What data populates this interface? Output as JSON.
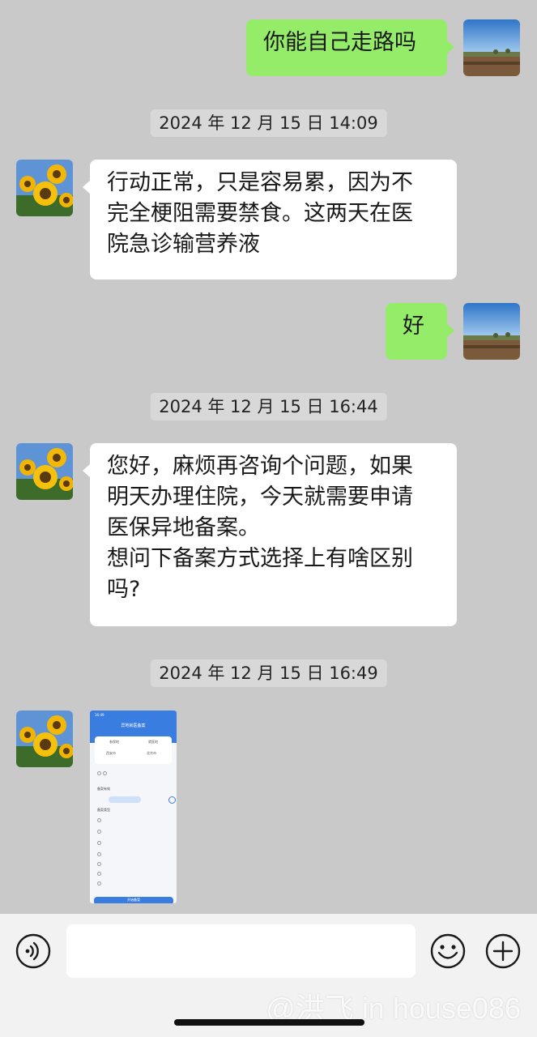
{
  "messages": [
    {
      "type": "text",
      "side": "right",
      "text": "你能自己走路吗"
    },
    {
      "type": "time",
      "text": "2024 年 12 月 15 日 14:09"
    },
    {
      "type": "text",
      "side": "left",
      "text": "行动正常，只是容易累，因为不\n完全梗阻需要禁食。这两天在医\n院急诊输营养液"
    },
    {
      "type": "text",
      "side": "right",
      "text": "好"
    },
    {
      "type": "time",
      "text": "2024 年 12 月 15 日 16:44"
    },
    {
      "type": "text",
      "side": "left",
      "text": "您好，麻烦再咨询个问题，如果\n明天办理住院，今天就需要申请\n医保异地备案。\n想问下备案方式选择上有啥区别\n吗?"
    },
    {
      "type": "time",
      "text": "2024 年 12 月 15 日 16:49"
    },
    {
      "type": "image",
      "side": "left"
    }
  ],
  "screenshot_thumbnail": {
    "status_time": "16:49",
    "title": "异地就医备案",
    "from_label": "参保地",
    "from_value": "西安市",
    "to_label": "就医地",
    "to_value": "北京市",
    "section_time": "备案有效",
    "section_type": "备案类型",
    "submit_label": "开始备案"
  },
  "input_bar": {
    "placeholder": "",
    "voice_icon": "voice-icon",
    "emoji_icon": "emoji-icon",
    "plus_icon": "plus-icon"
  },
  "watermark": "@洪飞 in house086",
  "colors": {
    "background": "#c9c9c9",
    "self_bubble": "#95ec69",
    "other_bubble": "#ffffff",
    "timestamp_bg": "#d8d8d8"
  }
}
